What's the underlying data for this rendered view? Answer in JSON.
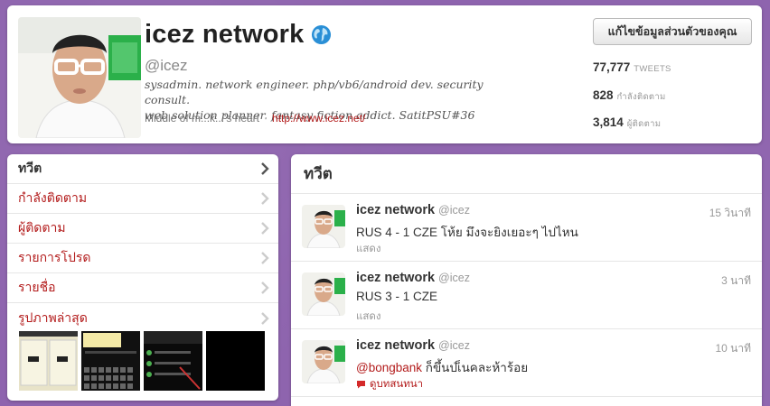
{
  "profile": {
    "name": "icez network",
    "screen_name": "@icez",
    "bio_line1": "sysadmin. network engineer. php/vb6/android dev. security consult.",
    "bio_line2": "web solution planner. fantasy fiction addict. SatitPSU#36",
    "location": "Middle of m...k...'s heart",
    "url": "http://www.icez.net/",
    "edit_button": "แก้ไขข้อมูลส่วนตัวของคุณ",
    "stats": [
      {
        "num": "77,777",
        "label": "TWEETS"
      },
      {
        "num": "828",
        "label": "กำลังติดตาม"
      },
      {
        "num": "3,814",
        "label": "ผู้ติดตาม"
      }
    ]
  },
  "nav": {
    "items": [
      {
        "label": "ทวีต",
        "icon": "chevron-right-icon"
      },
      {
        "label": "กำลังติดตาม",
        "icon": "chevron-right-icon"
      },
      {
        "label": "ผู้ติดตาม",
        "icon": "chevron-right-icon"
      },
      {
        "label": "รายการโปรด",
        "icon": "chevron-right-icon"
      },
      {
        "label": "รายชื่อ",
        "icon": "chevron-right-icon"
      },
      {
        "label": "รูปภาพล่าสุด",
        "icon": "chevron-right-icon"
      }
    ]
  },
  "timeline": {
    "title": "ทวีต",
    "tweets": [
      {
        "name": "icez network",
        "screen_name": "@icez",
        "time": "15 วินาที",
        "mention": "",
        "text": "RUS 4 - 1 CZE โห้ย มึงจะยิงเยอะๆ ไปไหน",
        "action": "แสดง",
        "action_icon": ""
      },
      {
        "name": "icez network",
        "screen_name": "@icez",
        "time": "3 นาที",
        "mention": "",
        "text": "RUS 3 - 1 CZE",
        "action": "แสดง",
        "action_icon": ""
      },
      {
        "name": "icez network",
        "screen_name": "@icez",
        "time": "10 นาที",
        "mention": "@bongbank",
        "text": " ก็ขึ้นป่เ็นคละห้าร้อย",
        "action": "ดูบทสนทนา",
        "action_icon": "conversation-icon"
      }
    ]
  },
  "colors": {
    "background": "#8e64ae",
    "link": "#b31b1b",
    "globe": "#2a8fd6"
  }
}
